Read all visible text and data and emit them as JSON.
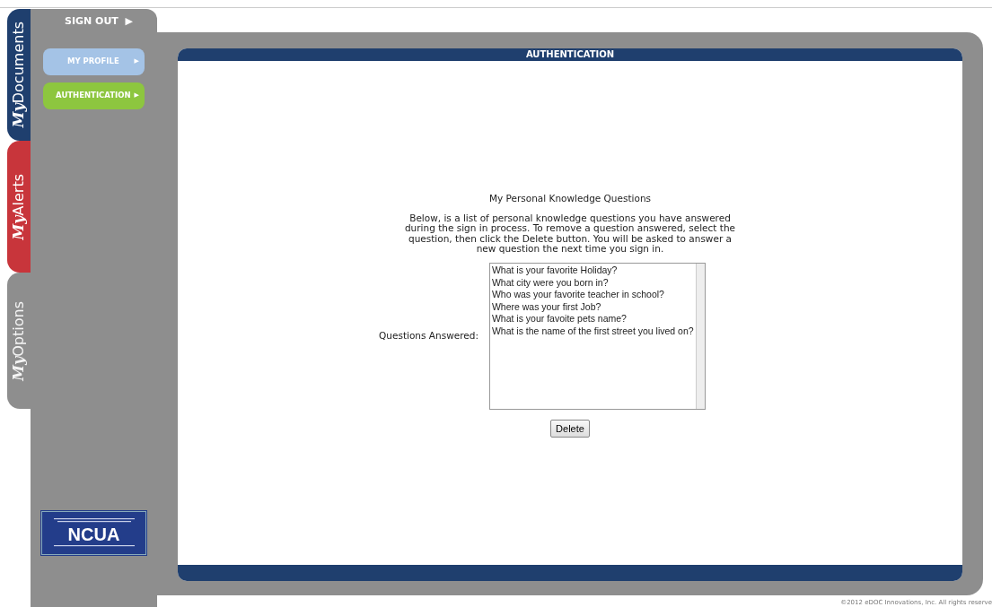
{
  "side_tabs": [
    {
      "prefix": "My",
      "label": "Documents",
      "color": "#1f3f6e",
      "selected": false
    },
    {
      "prefix": "My",
      "label": "Alerts",
      "color": "#c8353b",
      "selected": false
    },
    {
      "prefix": "My",
      "label": "Options",
      "color": "#8e8e8e",
      "selected": true
    }
  ],
  "sign_out": "SIGN OUT",
  "sign_out_arrow": "▶",
  "nav": [
    {
      "label": "MY PROFILE",
      "arrow": "▶",
      "selected": false
    },
    {
      "label": "AUTHENTICATION",
      "arrow": "▶",
      "selected": true
    }
  ],
  "badge": {
    "title": "NCUA"
  },
  "panel": {
    "title": "AUTHENTICATION",
    "heading": "My Personal Knowledge Questions",
    "intro": "Below, is a list of personal knowledge questions you have answered during the sign in process. To remove a question answered, select the question, then click the Delete button. You will be asked to answer a new question the next time you sign in.",
    "list_label": "Questions Answered:",
    "questions": [
      {
        "text": "What is your favorite Holiday?",
        "selected": false
      },
      {
        "text": "What city were you born in?",
        "selected": false
      },
      {
        "text": "Who was your favorite teacher in school?",
        "selected": false
      },
      {
        "text": "Where was your first Job?",
        "selected": false
      },
      {
        "text": "What is your favoite pets name?",
        "selected": false
      },
      {
        "text": "What is the name of the first street you lived on?",
        "selected": false
      }
    ],
    "delete_button": "Delete"
  },
  "footer": "©2012 eDOC Innovations, Inc. All rights reserve"
}
